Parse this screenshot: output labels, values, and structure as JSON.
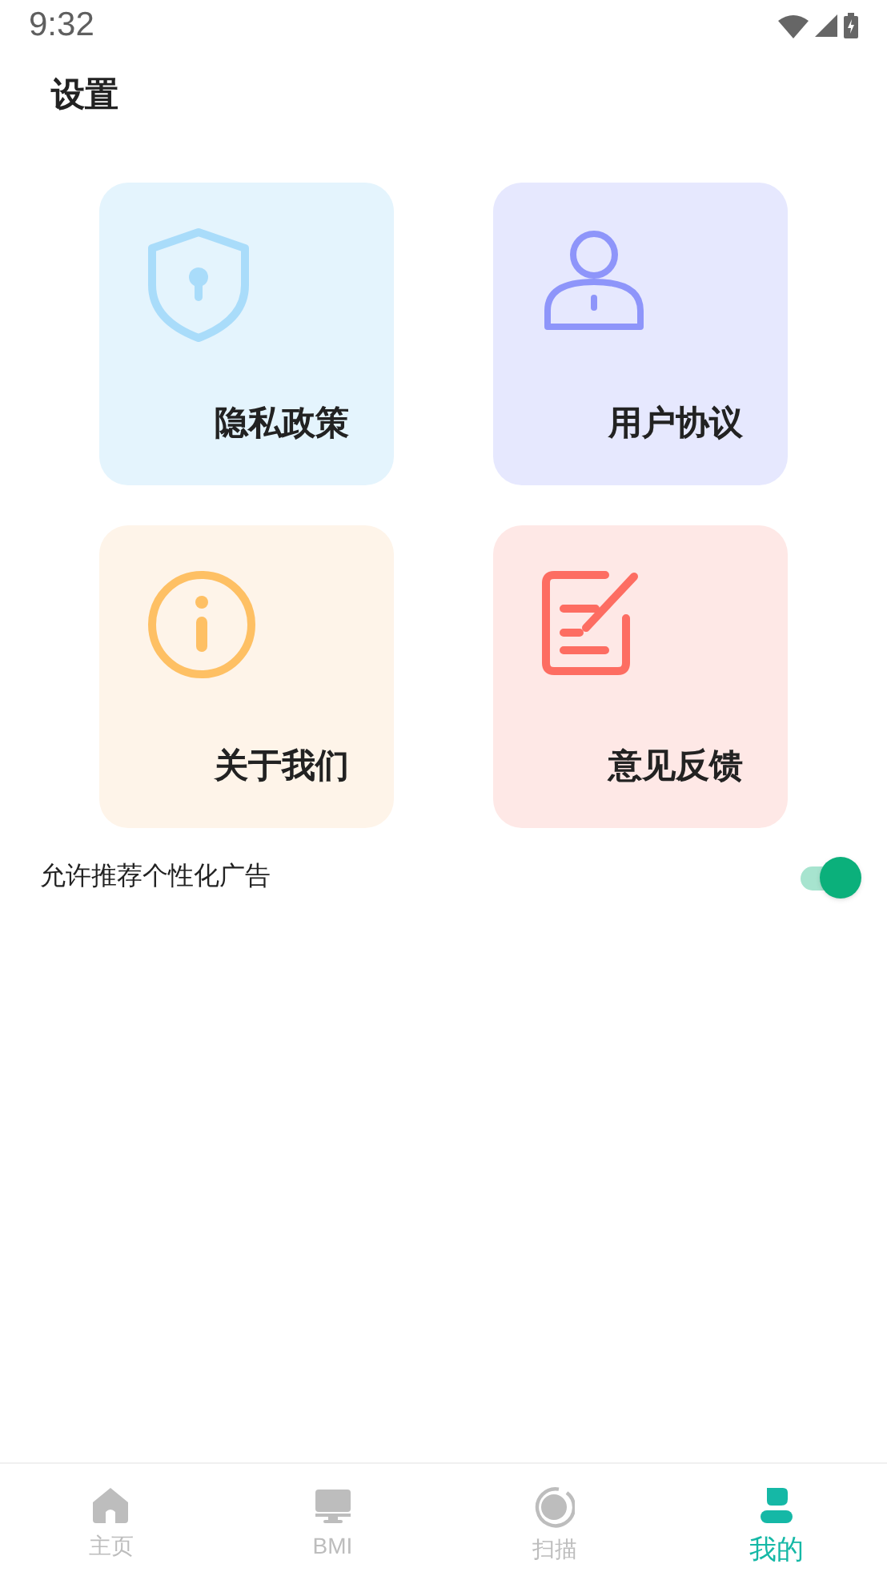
{
  "status_bar": {
    "time": "9:32"
  },
  "title": "设置",
  "cards": [
    {
      "kind": "privacy",
      "label": "隐私政策"
    },
    {
      "kind": "agreement",
      "label": "用户协议"
    },
    {
      "kind": "about",
      "label": "关于我们"
    },
    {
      "kind": "feedback",
      "label": "意见反馈"
    }
  ],
  "ad_setting": {
    "label": "允许推荐个性化广告",
    "on": true
  },
  "tabs": [
    {
      "kind": "home",
      "label": "主页",
      "selected": false
    },
    {
      "kind": "bmi",
      "label": "BMI",
      "selected": false
    },
    {
      "kind": "scan",
      "label": "扫描",
      "selected": false
    },
    {
      "kind": "mine",
      "label": "我的",
      "selected": true
    }
  ]
}
